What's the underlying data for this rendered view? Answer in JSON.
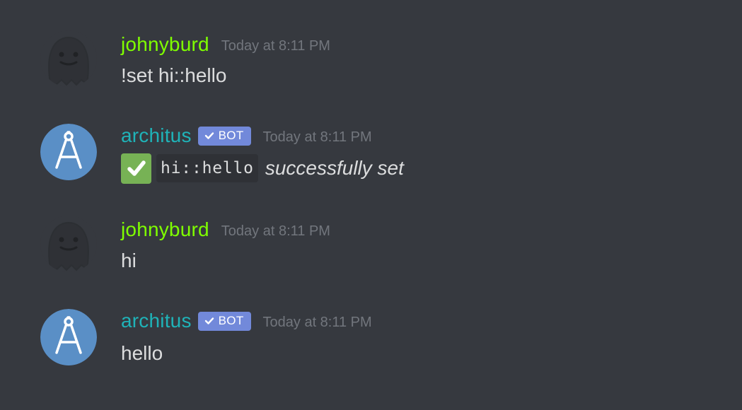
{
  "colors": {
    "background": "#36393f",
    "user_name": "#7fff00",
    "bot_name": "#1fb3b8",
    "bot_tag": "#7289da",
    "timestamp": "#72767d",
    "message_text": "#dcddde",
    "inline_code_background": "#2f3136",
    "checkmark_emoji_background": "#77b255",
    "bot_avatar_background": "#5a8fc6"
  },
  "messages": [
    {
      "author": "johnyburd",
      "author_type": "user",
      "timestamp": "Today at 8:11 PM",
      "content": "!set hi::hello",
      "avatar_icon": "ghost-icon"
    },
    {
      "author": "architus",
      "author_type": "bot",
      "bot_tag": "BOT",
      "timestamp": "Today at 8:11 PM",
      "content": {
        "emoji": "white-check-mark-icon",
        "code": "hi::hello",
        "text": "successfully set"
      },
      "avatar_icon": "compass-icon"
    },
    {
      "author": "johnyburd",
      "author_type": "user",
      "timestamp": "Today at 8:11 PM",
      "content": "hi",
      "avatar_icon": "ghost-icon"
    },
    {
      "author": "architus",
      "author_type": "bot",
      "bot_tag": "BOT",
      "timestamp": "Today at 8:11 PM",
      "content": "hello",
      "avatar_icon": "compass-icon"
    }
  ]
}
